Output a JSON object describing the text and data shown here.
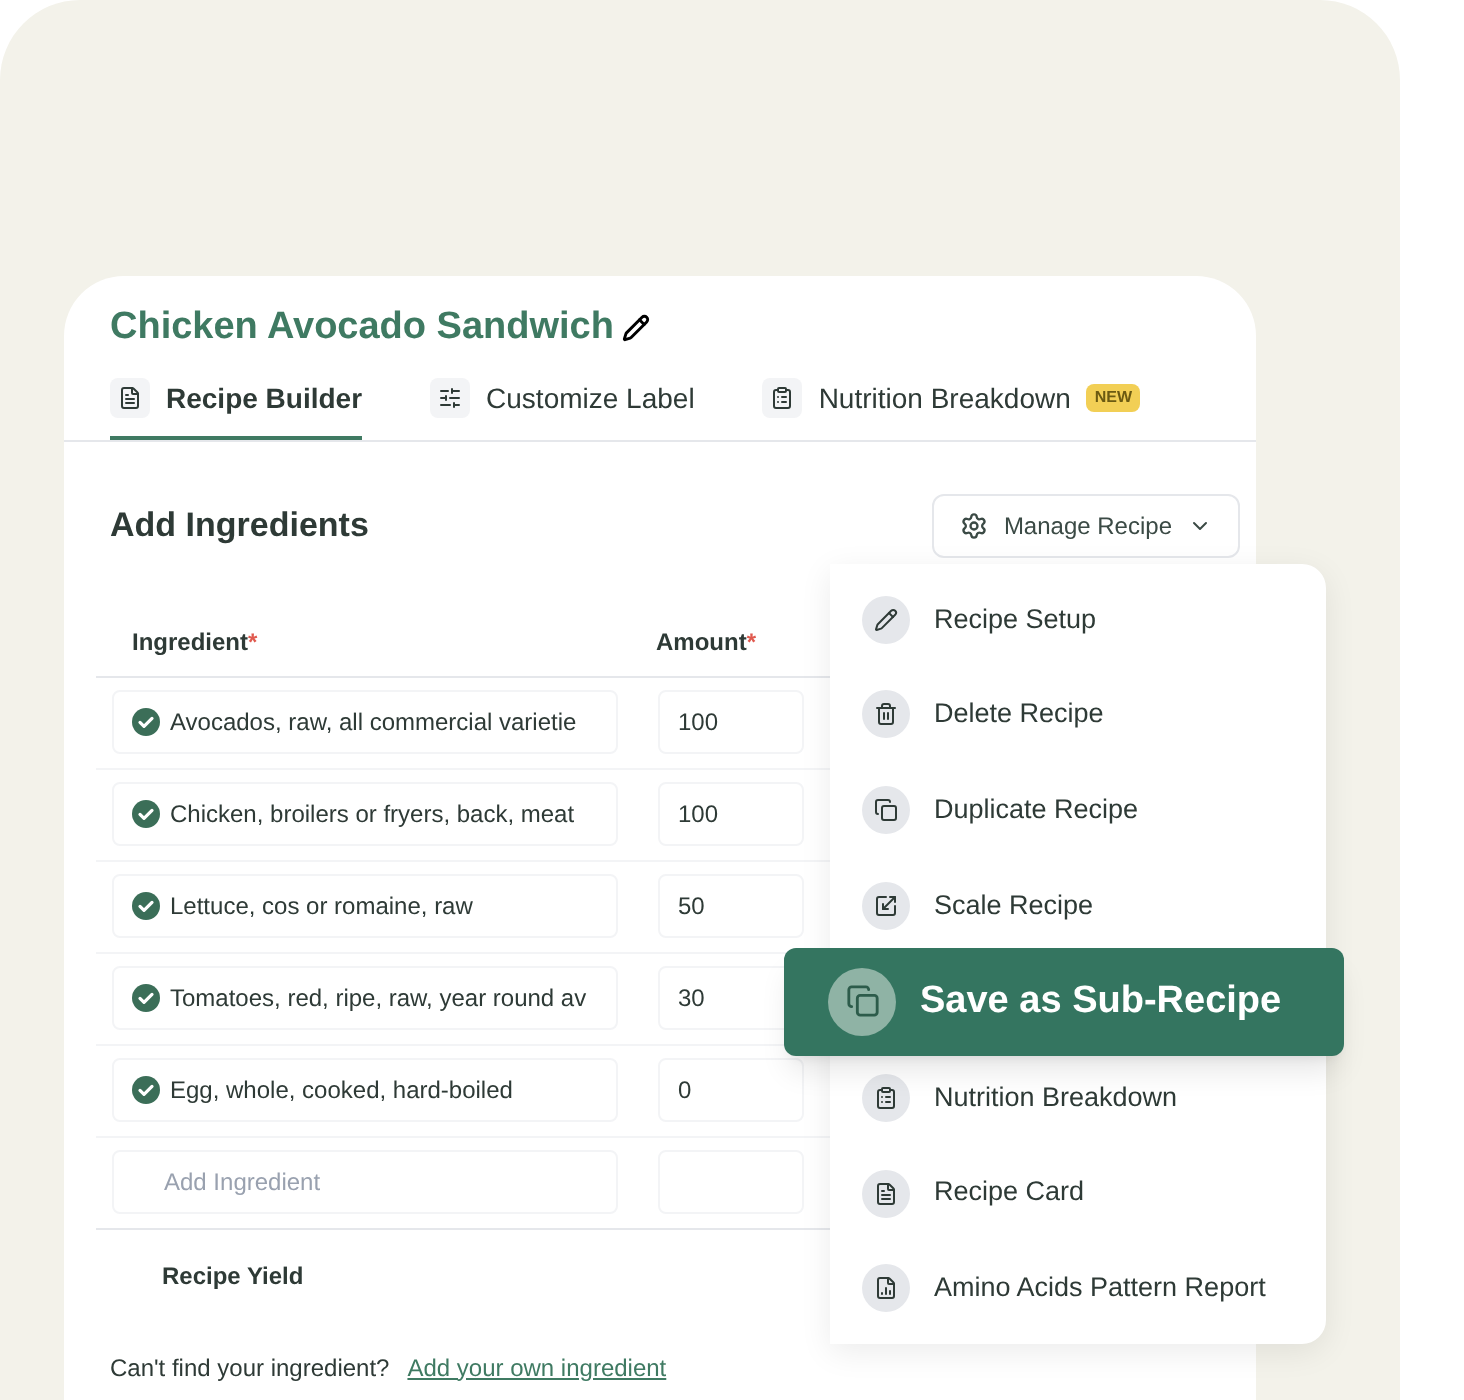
{
  "recipe": {
    "title": "Chicken Avocado Sandwich"
  },
  "tabs": [
    {
      "label": "Recipe Builder",
      "selected": true
    },
    {
      "label": "Customize Label",
      "selected": false
    },
    {
      "label": "Nutrition Breakdown",
      "selected": false,
      "badge": "NEW"
    }
  ],
  "section_title": "Add Ingredients",
  "manage_button": "Manage Recipe",
  "table": {
    "columns": [
      {
        "label": "Ingredient",
        "required": "*"
      },
      {
        "label": "Amount",
        "required": "*"
      }
    ],
    "rows": [
      {
        "ingredient": "Avocados, raw, all commercial varietie",
        "amount": "100",
        "matched": true
      },
      {
        "ingredient": "Chicken, broilers or fryers, back, meat",
        "amount": "100",
        "matched": true
      },
      {
        "ingredient": "Lettuce, cos or romaine, raw",
        "amount": "50",
        "matched": true
      },
      {
        "ingredient": "Tomatoes, red, ripe, raw, year round av",
        "amount": "30",
        "matched": true
      },
      {
        "ingredient": "Egg, whole, cooked, hard-boiled",
        "amount": "0",
        "matched": true
      }
    ],
    "new_row": {
      "placeholder": "Add Ingredient"
    },
    "yield_label": "Recipe Yield"
  },
  "footer": {
    "text": "Can't find your ingredient?",
    "link": "Add your own ingredient"
  },
  "menu": [
    {
      "label": "Recipe Setup",
      "selected": false
    },
    {
      "label": "Delete Recipe",
      "selected": false
    },
    {
      "label": "Duplicate Recipe",
      "selected": false
    },
    {
      "label": "Scale Recipe",
      "selected": false
    },
    {
      "label": "Save as Sub-Recipe",
      "selected": true
    },
    {
      "label": "Nutrition Breakdown",
      "selected": false
    },
    {
      "label": "Recipe Card",
      "selected": false
    },
    {
      "label": "Amino Acids Pattern Report",
      "selected": false
    }
  ]
}
